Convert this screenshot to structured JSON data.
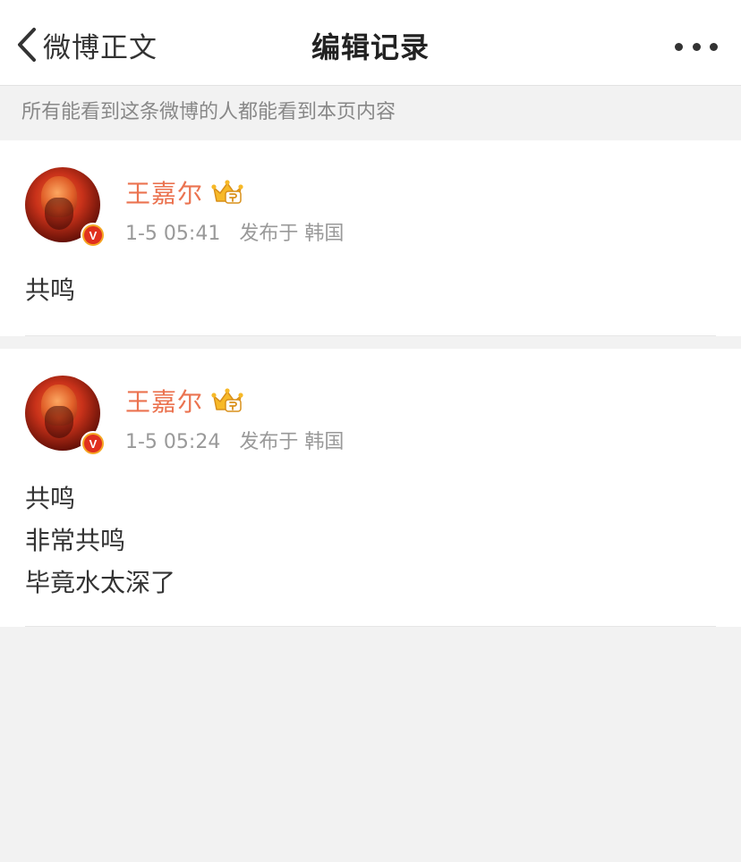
{
  "navbar": {
    "back_label": "微博正文",
    "title": "编辑记录"
  },
  "notice": "所有能看到这条微博的人都能看到本页内容",
  "posts": [
    {
      "user_name": "王嘉尔",
      "verified_badge": "V",
      "time": "1-5 05:41",
      "location": "发布于 韩国",
      "lines": [
        "共鸣"
      ]
    },
    {
      "user_name": "王嘉尔",
      "verified_badge": "V",
      "time": "1-5 05:24",
      "location": "发布于 韩国",
      "lines": [
        "共鸣",
        "非常共鸣",
        "毕竟水太深了"
      ]
    }
  ],
  "colors": {
    "accent_name": "#eb7350",
    "meta_text": "#999999",
    "background": "#f2f2f2"
  },
  "icons": {
    "back": "chevron-left-icon",
    "more": "more-dots-icon",
    "membership": "crown-icon",
    "verified": "verified-v-icon"
  }
}
